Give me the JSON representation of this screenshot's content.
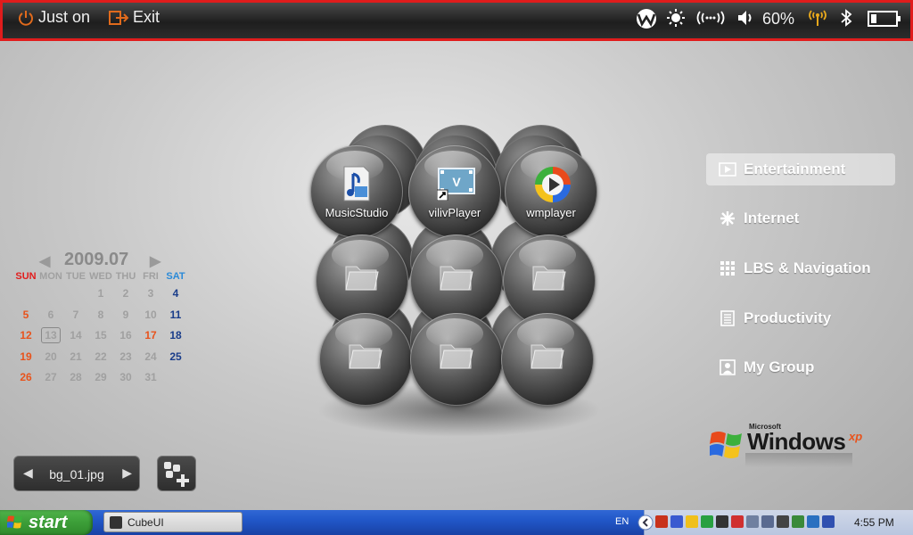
{
  "topbar": {
    "just_on_label": "Just on",
    "exit_label": "Exit",
    "battery_percent_label": "60%",
    "icons": [
      "power-icon",
      "exit-icon",
      "wibro-icon",
      "brightness-icon",
      "wifi-icon",
      "volume-icon",
      "signal-icon",
      "bluetooth-icon",
      "battery-icon"
    ],
    "accent_color": "#e06a1c",
    "highlight_border_color": "#e01c1c"
  },
  "cube": {
    "apps": [
      {
        "label": "MusicStudio",
        "icon": "music-studio-icon"
      },
      {
        "label": "vilivPlayer",
        "icon": "viliv-player-icon"
      },
      {
        "label": "wmplayer",
        "icon": "windows-media-player-icon"
      }
    ],
    "empty_slot_icon": "folder-icon"
  },
  "calendar": {
    "title": "2009.07",
    "weekdays": [
      "SUN",
      "MON",
      "TUE",
      "WED",
      "THU",
      "FRI",
      "SAT"
    ],
    "weeks": [
      [
        "",
        "",
        "",
        "1",
        "2",
        "3",
        "4"
      ],
      [
        "5",
        "6",
        "7",
        "8",
        "9",
        "10",
        "11"
      ],
      [
        "12",
        "13",
        "14",
        "15",
        "16",
        "17",
        "18"
      ],
      [
        "19",
        "20",
        "21",
        "22",
        "23",
        "24",
        "25"
      ],
      [
        "26",
        "27",
        "28",
        "29",
        "30",
        "31",
        ""
      ]
    ],
    "today": "13",
    "holiday": "17",
    "colors": {
      "sunday": "#e8531c",
      "saturday": "#1a3d8a",
      "weekday": "#a0a0a0",
      "holiday": "#e8531c",
      "sun_header": "#e21c1c",
      "sat_header": "#2a8ad8"
    }
  },
  "menu": {
    "items": [
      {
        "label": "Entertainment",
        "icon": "entertainment-icon",
        "active": true
      },
      {
        "label": "Internet",
        "icon": "internet-icon",
        "active": false
      },
      {
        "label": "LBS & Navigation",
        "icon": "navigation-icon",
        "active": false
      },
      {
        "label": "Productivity",
        "icon": "productivity-icon",
        "active": false
      },
      {
        "label": "My Group",
        "icon": "my-group-icon",
        "active": false
      }
    ]
  },
  "os_logo": {
    "microsoft": "Microsoft",
    "windows": "Windows",
    "xp": "xp"
  },
  "background_selector": {
    "filename": "bg_01.jpg"
  },
  "taskbar": {
    "start_label": "start",
    "task_label": "CubeUI",
    "language": "EN",
    "clock": "4:55 PM"
  }
}
